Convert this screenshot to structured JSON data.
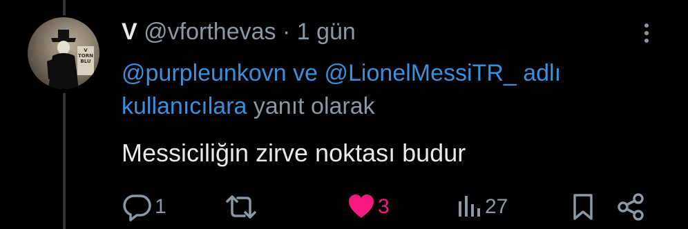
{
  "tweet": {
    "display_name": "V",
    "handle": "@vforthevas",
    "separator": "·",
    "time": "1 gün",
    "reply_mention_1": "@purpleunkovn",
    "reply_and": "ve",
    "reply_mention_2": "@LionelMessiTR_",
    "reply_suffix_1": "adlı",
    "reply_users": "kullanıcılara",
    "reply_suffix_2": "yanıt olarak",
    "text": "Messiciliğin zirve noktası budur",
    "avatar_poster_text": "V\nTORN\nBLU"
  },
  "actions": {
    "reply_count": "1",
    "retweet_count": "",
    "like_count": "3",
    "views_count": "27"
  },
  "icons": [
    "more-vertical-icon",
    "reply-icon",
    "retweet-icon",
    "heart-icon",
    "views-icon",
    "bookmark-icon",
    "share-icon"
  ],
  "colors": {
    "background": "#000000",
    "text": "#e7e9ea",
    "muted": "#8b98a5",
    "link": "#3b8fdb",
    "like": "#f91880"
  }
}
